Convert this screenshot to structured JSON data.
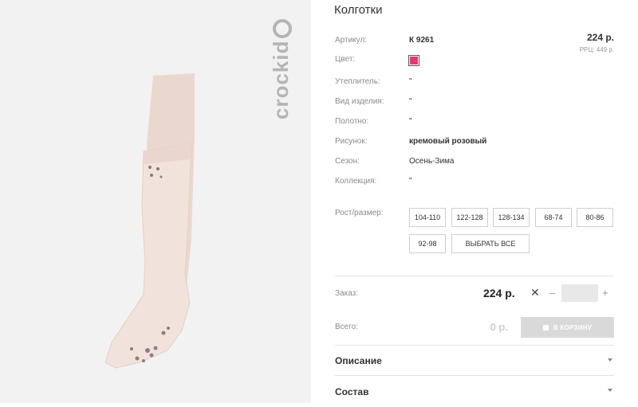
{
  "product": {
    "title": "Колготки",
    "brand": "crockid",
    "price": "224 р.",
    "rrc": "РРЦ: 449 р."
  },
  "attributes": [
    {
      "label": "Артикул:",
      "value": "К 9261"
    },
    {
      "label": "Цвет:",
      "value": ""
    },
    {
      "label": "Утеплитель:",
      "value": "\""
    },
    {
      "label": "Вид изделия:",
      "value": "\""
    },
    {
      "label": "Полотно:",
      "value": "\""
    },
    {
      "label": "Рисунок:",
      "value": "кремовый розовый"
    },
    {
      "label": "Сезон:",
      "value": "Осень-Зима"
    },
    {
      "label": "Коллекция:",
      "value": "\""
    }
  ],
  "sizes": {
    "label": "Рост/размер:",
    "options": [
      "104-110",
      "122-128",
      "128-134",
      "68-74",
      "80-86",
      "92-98"
    ],
    "select_all": "ВЫБРАТЬ ВСЕ"
  },
  "order": {
    "label": "Заказ:",
    "price": "224 р.",
    "times": "✕",
    "minus": "–",
    "plus": "+",
    "qty_value": ""
  },
  "total": {
    "label": "Всего:",
    "value": "0 р.",
    "cart_button": "В КОРЗИНУ"
  },
  "accordions": [
    "Описание",
    "Состав"
  ],
  "colors": {
    "swatch": "#e8396e",
    "garment": "#efe0d8",
    "cart_disabled": "#d9d9d9"
  }
}
